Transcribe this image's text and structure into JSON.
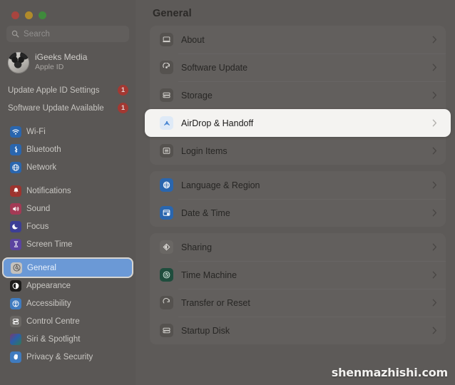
{
  "window": {
    "traffic_lights": [
      {
        "name": "close",
        "color": "#a8453f"
      },
      {
        "name": "minimize",
        "color": "#b08a2a"
      },
      {
        "name": "zoom",
        "color": "#3f8a3c"
      }
    ]
  },
  "sidebar": {
    "search": {
      "placeholder": "Search",
      "value": ""
    },
    "account": {
      "name": "iGeeks Media",
      "subtitle": "Apple ID"
    },
    "notices": [
      {
        "label": "Update Apple ID Settings",
        "badge": "1"
      },
      {
        "label": "Software Update Available",
        "badge": "1"
      }
    ],
    "groups": [
      {
        "items": [
          {
            "label": "Wi-Fi",
            "icon": "wifi-icon",
            "style": "blue",
            "glyph": "◝",
            "selected": false
          },
          {
            "label": "Bluetooth",
            "icon": "bluetooth-icon",
            "style": "blue",
            "glyph": "ᛗ",
            "selected": false
          },
          {
            "label": "Network",
            "icon": "network-globe-icon",
            "style": "blue",
            "glyph": "⊕",
            "selected": false
          }
        ]
      },
      {
        "items": [
          {
            "label": "Notifications",
            "icon": "bell-icon",
            "style": "red",
            "glyph": "▲",
            "selected": false
          },
          {
            "label": "Sound",
            "icon": "speaker-icon",
            "style": "pink",
            "glyph": "◀",
            "selected": false
          },
          {
            "label": "Focus",
            "icon": "moon-icon",
            "style": "indigo",
            "glyph": "☾",
            "selected": false
          },
          {
            "label": "Screen Time",
            "icon": "hourglass-icon",
            "style": "purple",
            "glyph": "⧗",
            "selected": false
          }
        ]
      },
      {
        "items": [
          {
            "label": "General",
            "icon": "gear-icon",
            "style": "white-gear",
            "glyph": "⚙",
            "selected": true
          },
          {
            "label": "Appearance",
            "icon": "appearance-contrast-icon",
            "style": "black",
            "glyph": "◑",
            "selected": false
          },
          {
            "label": "Accessibility",
            "icon": "accessibility-icon",
            "style": "lightblue",
            "glyph": "Ⓙ",
            "selected": false
          },
          {
            "label": "Control Centre",
            "icon": "control-centre-icon",
            "style": "gray",
            "glyph": "⌸",
            "selected": false
          },
          {
            "label": "Siri & Spotlight",
            "icon": "siri-icon",
            "style": "rainbow",
            "glyph": "●",
            "selected": false
          },
          {
            "label": "Privacy & Security",
            "icon": "privacy-hand-icon",
            "style": "lightblue",
            "glyph": "✋",
            "selected": false
          }
        ]
      }
    ]
  },
  "main": {
    "title": "General",
    "groups": [
      {
        "rows": [
          {
            "label": "About",
            "icon": "about-laptop-icon",
            "highlighted": false
          },
          {
            "label": "Software Update",
            "icon": "software-update-icon",
            "highlighted": false
          },
          {
            "label": "Storage",
            "icon": "storage-drive-icon",
            "highlighted": false
          },
          {
            "label": "AirDrop & Handoff",
            "icon": "airdrop-icon",
            "highlighted": true
          },
          {
            "label": "Login Items",
            "icon": "login-items-icon",
            "highlighted": false
          }
        ]
      },
      {
        "rows": [
          {
            "label": "Language & Region",
            "icon": "language-region-globe-icon",
            "highlighted": false
          },
          {
            "label": "Date & Time",
            "icon": "date-time-icon",
            "highlighted": false
          }
        ]
      },
      {
        "rows": [
          {
            "label": "Sharing",
            "icon": "sharing-icon",
            "highlighted": false
          },
          {
            "label": "Time Machine",
            "icon": "time-machine-icon",
            "highlighted": false
          },
          {
            "label": "Transfer or Reset",
            "icon": "transfer-reset-icon",
            "highlighted": false
          },
          {
            "label": "Startup Disk",
            "icon": "startup-disk-icon",
            "highlighted": false
          }
        ]
      }
    ]
  },
  "watermark": {
    "text": "shenmazhishi.com"
  },
  "colors": {
    "sidebar_bg": "#5a5755",
    "main_bg": "#5d5a58",
    "selection_blue": "#6b99d6",
    "badge_red": "#a33832",
    "highlight_card": "#f4f3f1"
  }
}
